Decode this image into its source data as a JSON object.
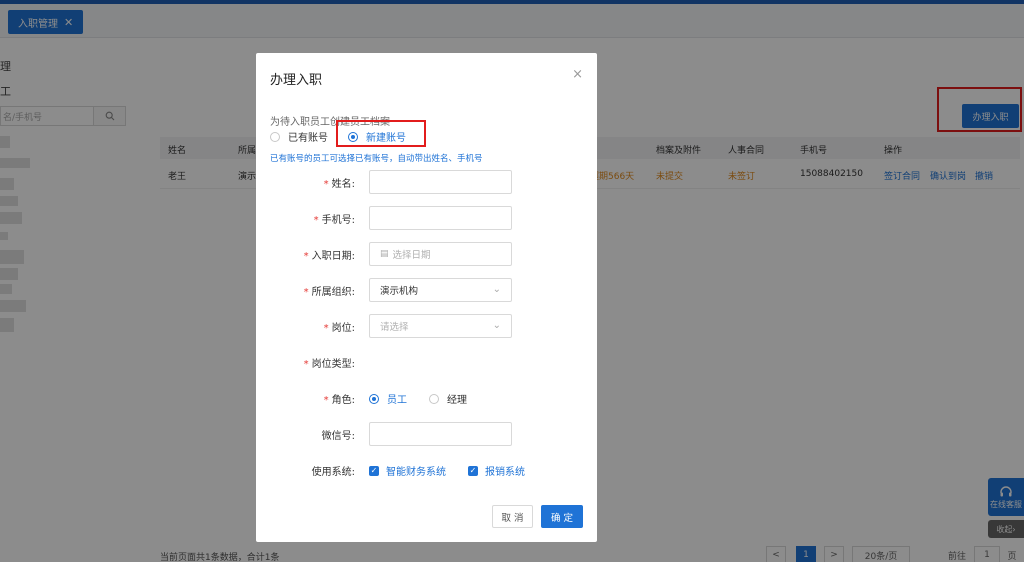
{
  "tab": {
    "label": "入职管理",
    "close": "✕"
  },
  "background": {
    "left_fragments": [
      "理",
      "工"
    ],
    "search_placeholder": "名/手机号",
    "primary_button": "办理入职",
    "table": {
      "headers": [
        "姓名",
        "所属",
        "档案及附件",
        "人事合同",
        "手机号",
        "操作"
      ],
      "row": {
        "name": "老王",
        "org": "演示",
        "overdue": "超期566天",
        "file_status": "未提交",
        "contract_status": "未签订",
        "phone": "15088402150",
        "actions": [
          "签订合同",
          "确认到岗",
          "撤销"
        ]
      }
    },
    "footer": "当前页面共1条数据，合计1条",
    "pager": {
      "prev": "<",
      "page": "1",
      "next": ">",
      "size": "20条/页",
      "goto_label": "前往",
      "goto_value": "1",
      "goto_suffix": "页"
    },
    "side_widget": "在线客服",
    "collapse": "收起"
  },
  "modal": {
    "title": "办理入职",
    "close": "×",
    "desc": "为待入职员工创建员工档案",
    "account_options": [
      "已有账号",
      "新建账号"
    ],
    "hint": "已有账号的员工可选择已有账号，自动带出姓名、手机号",
    "fields": {
      "name": "姓名:",
      "phone": "手机号:",
      "date": "入职日期:",
      "date_placeholder": "选择日期",
      "org": "所属组织:",
      "org_value": "演示机构",
      "post": "岗位:",
      "post_placeholder": "请选择",
      "post_type": "岗位类型:",
      "role": "角色:",
      "role_options": [
        "员工",
        "经理"
      ],
      "wechat": "微信号:",
      "system": "使用系统:",
      "system_options": [
        "智能财务系统",
        "报销系统"
      ]
    },
    "cancel": "取 消",
    "ok": "确 定"
  },
  "colors": {
    "accent": "#1f73d6",
    "highlight": "#e21c1c"
  }
}
